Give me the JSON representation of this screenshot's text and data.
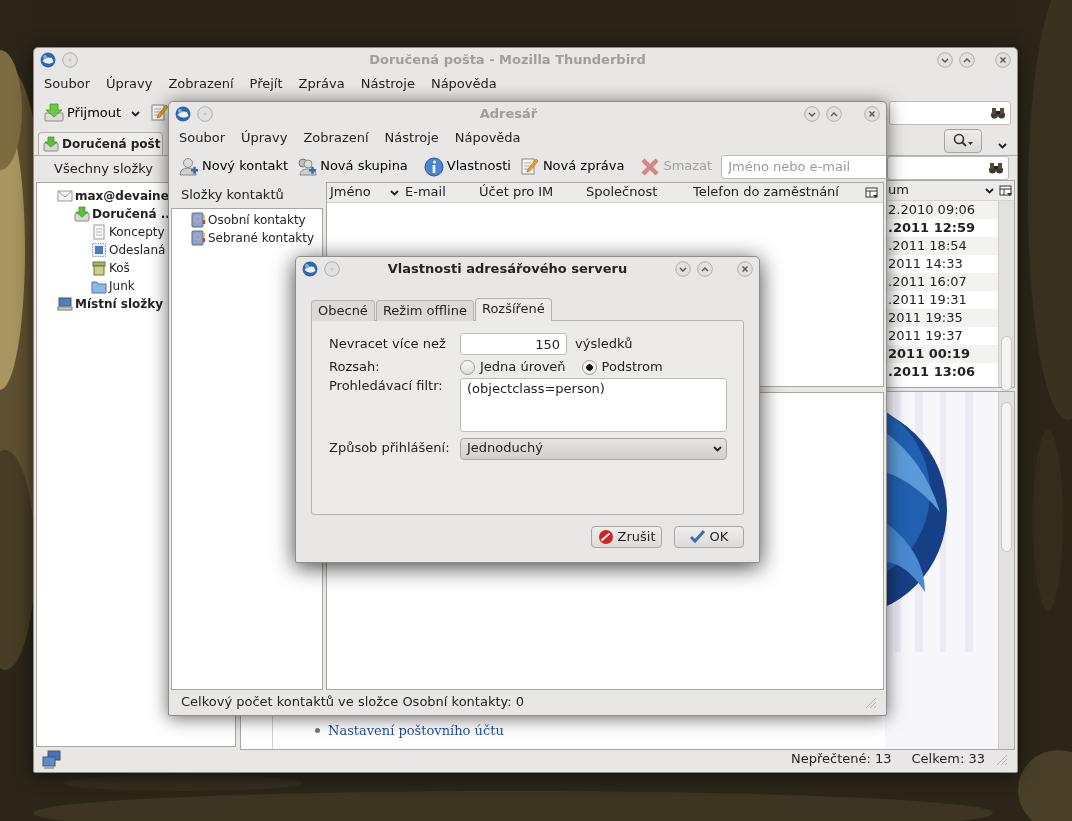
{
  "main_window": {
    "title": "Doručená pošta - Mozilla Thunderbird",
    "active": false,
    "menus": [
      "Soubor",
      "Úpravy",
      "Zobrazení",
      "Přejít",
      "Zpráva",
      "Nástroje",
      "Nápověda"
    ],
    "toolbar": {
      "get_mail": "Přijmout"
    },
    "tab": {
      "label": "Doručená pošt",
      "selected": true
    },
    "folder_pane": {
      "header": "Všechny složky",
      "folders": [
        {
          "label": "max@devaine",
          "kind": "account",
          "unread": true,
          "children": [
            {
              "label": "Doručená ..",
              "kind": "inbox",
              "unread": true,
              "children": [
                {
                  "label": "Koncepty",
                  "kind": "drafts",
                  "unread": false
                },
                {
                  "label": "Odeslaná",
                  "kind": "sent",
                  "unread": false
                },
                {
                  "label": "Koš",
                  "kind": "trash",
                  "unread": false
                },
                {
                  "label": "Junk",
                  "kind": "junk",
                  "unread": false
                }
              ]
            }
          ]
        },
        {
          "label": "Místní složky",
          "kind": "local",
          "unread": true
        }
      ]
    },
    "message_list": {
      "column": {
        "label": "um",
        "sorted": true
      },
      "rows": [
        {
          "date": "2.2010 09:06",
          "unread": false
        },
        {
          "date": ".2011 12:59",
          "unread": true
        },
        {
          "date": ".2011 18:54",
          "unread": false
        },
        {
          "date": "2011 14:33",
          "unread": false
        },
        {
          "date": ".2011 16:07",
          "unread": false
        },
        {
          "date": ".2011 19:31",
          "unread": false
        },
        {
          "date": "2011 19:35",
          "unread": false
        },
        {
          "date": "2011 19:37",
          "unread": false
        },
        {
          "date": "2011 00:19",
          "unread": true
        },
        {
          "date": ".2011 13:06",
          "unread": true
        }
      ]
    },
    "preview": {
      "link": "Nastavení poštovního účtu"
    },
    "status_bar": {
      "unread": "Nepřečtené: 13",
      "total": "Celkem: 33"
    }
  },
  "address_book": {
    "title": "Adresář",
    "active": false,
    "menus": [
      "Soubor",
      "Úpravy",
      "Zobrazení",
      "Nástroje",
      "Nápověda"
    ],
    "toolbar": [
      {
        "label": "Nový kontakt",
        "kind": "new-contact",
        "disabled": false
      },
      {
        "label": "Nová skupina",
        "kind": "new-group",
        "disabled": false
      },
      {
        "label": "Vlastnosti",
        "kind": "properties",
        "disabled": false
      },
      {
        "label": "Nová zpráva",
        "kind": "new-message",
        "disabled": false
      },
      {
        "label": "Smazat",
        "kind": "delete",
        "disabled": true
      }
    ],
    "search": {
      "placeholder": "Jméno nebo e-mail"
    },
    "folders_header": "Složky kontaktů",
    "books": [
      "Osobní kontakty",
      "Sebrané kontakty"
    ],
    "columns": [
      {
        "label": "Jméno",
        "sorted": true
      },
      {
        "label": "E-mail",
        "sorted": false
      },
      {
        "label": "Účet pro IM",
        "sorted": false
      },
      {
        "label": "Společnost",
        "sorted": false
      },
      {
        "label": "Telefon do zaměstnání",
        "sorted": false
      }
    ],
    "status": "Celkový počet kontaktů ve složce Osobní kontakty: 0"
  },
  "dialog": {
    "title": "Vlastnosti adresářového serveru",
    "active": true,
    "tabs": [
      {
        "label": "Obecné",
        "selected": false
      },
      {
        "label": "Režim offline",
        "selected": false
      },
      {
        "label": "Rozšířené",
        "selected": true
      }
    ],
    "max_results": {
      "label": "Nevracet více než",
      "value": "150",
      "unit": "výsledků"
    },
    "scope": {
      "label": "Rozsah:",
      "options": [
        {
          "label": "Jedna úroveň",
          "selected": false
        },
        {
          "label": "Podstrom",
          "selected": true
        }
      ]
    },
    "filter": {
      "label": "Prohledávací filtr:",
      "value": "(objectclass=person)"
    },
    "login": {
      "label": "Způsob přihlášení:",
      "value": "Jednoduchý"
    },
    "buttons": [
      {
        "label": "Zrušit",
        "kind": "cancel"
      },
      {
        "label": "OK",
        "kind": "ok"
      }
    ]
  }
}
